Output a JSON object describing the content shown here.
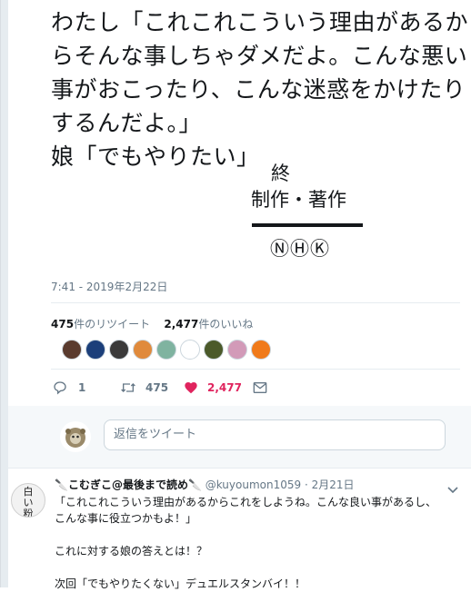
{
  "tweet": {
    "lines": [
      "わたし「これこれこういう理由があるか",
      "らそんな事しちゃダメだよ。こんな悪い",
      "事がおこったり、こんな迷惑をかけたり",
      "するんだよ。」",
      "娘「でもやりたい」"
    ],
    "end_kanji": "終",
    "end_credit": "制作・著作",
    "end_nhk": "ⓃⒽⓀ",
    "timestamp": "7:41 - 2019年2月22日",
    "retweet_count": "475",
    "retweet_label": "件のリツイート",
    "like_count": "2,477",
    "like_label": "件のいいね",
    "actions": {
      "reply_count": "1",
      "retweet_count": "475",
      "like_count": "2,477"
    },
    "liker_avatar_colors": [
      "#5a3b2e",
      "#1c3f7a",
      "#3a3a3a",
      "#e08a3c",
      "#7fb3a0",
      "#ffffff",
      "#4b5a2a",
      "#d29ab8",
      "#f07a1a"
    ]
  },
  "reply_box": {
    "placeholder": "返信をツイート"
  },
  "reply_tweet": {
    "name": "🔪こむぎこ@最後まで読め🔪",
    "handle": "@kuyoumon1059",
    "date": "· 2月21日",
    "avatar_text": "白い粉",
    "body_lines": [
      "「これこれこういう理由があるからこれをしようね。こんな良い事があるし、",
      "こんな事に役立つかもよ！」",
      "",
      "これに対する娘の答えとは！？",
      "",
      "次回「でもやりたくない」デュエルスタンバイ！！"
    ]
  },
  "colors": {
    "like_red": "#e0245e",
    "secondary_text": "#657786",
    "divider": "#e6ecf0"
  }
}
